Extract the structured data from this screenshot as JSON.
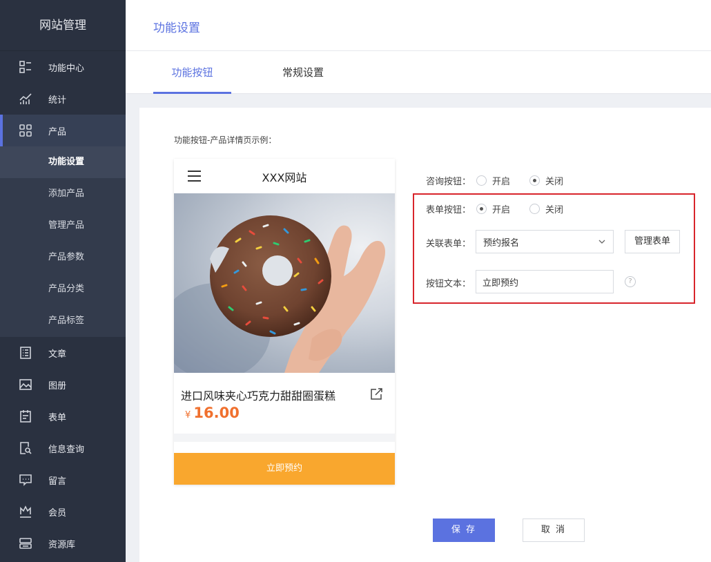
{
  "sidebar": {
    "title": "网站管理",
    "items": [
      {
        "label": "功能中心",
        "icon": "list-grid-icon"
      },
      {
        "label": "统计",
        "icon": "chart-icon"
      },
      {
        "label": "产品",
        "icon": "apps-icon"
      },
      {
        "label": "文章",
        "icon": "article-icon"
      },
      {
        "label": "图册",
        "icon": "image-icon"
      },
      {
        "label": "表单",
        "icon": "clipboard-icon"
      },
      {
        "label": "信息查询",
        "icon": "search-doc-icon"
      },
      {
        "label": "留言",
        "icon": "message-icon"
      },
      {
        "label": "会员",
        "icon": "crown-icon"
      },
      {
        "label": "资源库",
        "icon": "storage-icon"
      }
    ],
    "sub_items": [
      "功能设置",
      "添加产品",
      "管理产品",
      "产品参数",
      "产品分类",
      "产品标签"
    ]
  },
  "header": {
    "title": "功能设置"
  },
  "tabs": [
    {
      "label": "功能按钮"
    },
    {
      "label": "常规设置"
    }
  ],
  "preview": {
    "label": "功能按钮-产品详情页示例：",
    "site_name": "XXX网站",
    "product_title": "进口风味夹心巧克力甜甜圈蛋糕",
    "currency": "¥",
    "price": "16.00",
    "button_text": "立即预约"
  },
  "form": {
    "consult_label": "咨询按钮：",
    "consult_options": [
      "开启",
      "关闭"
    ],
    "consult_selected": "关闭",
    "form_btn_label": "表单按钮：",
    "form_btn_options": [
      "开启",
      "关闭"
    ],
    "form_btn_selected": "开启",
    "linked_form_label": "关联表单：",
    "linked_form_value": "预约报名",
    "manage_form_label": "管理表单",
    "button_text_label": "按钮文本：",
    "button_text_value": "立即预约",
    "help": "?"
  },
  "actions": {
    "save": "保 存",
    "cancel": "取 消"
  },
  "colors": {
    "accent": "#5b72e0",
    "sidebar": "#2a3140",
    "price": "#f0702e",
    "cta": "#f9a72e",
    "highlight": "#d8242b"
  }
}
